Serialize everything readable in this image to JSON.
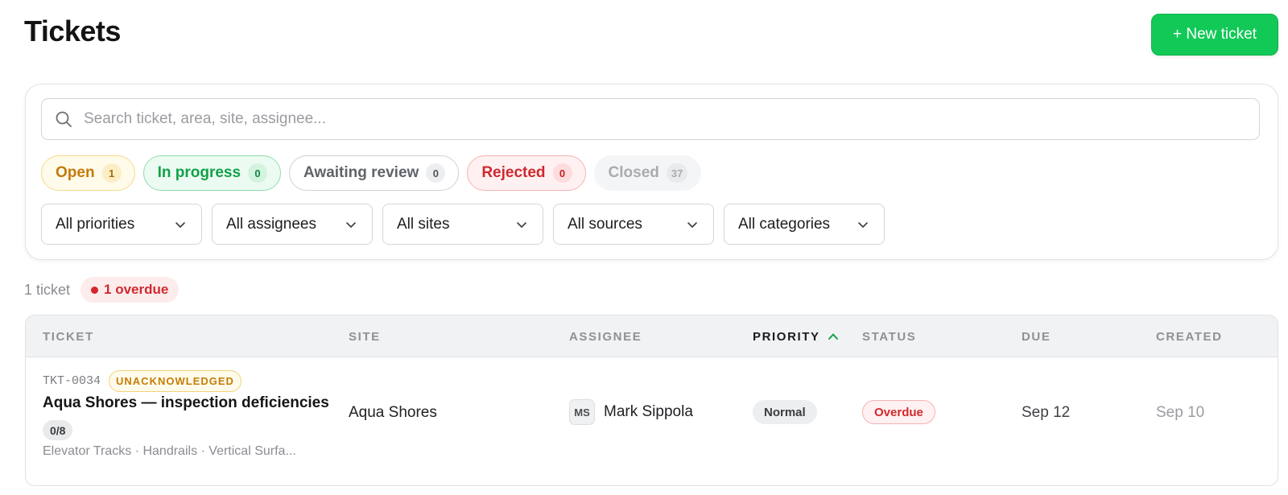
{
  "page": {
    "title": "Tickets"
  },
  "header": {
    "new_ticket_label": "+ New ticket"
  },
  "search": {
    "placeholder": "Search ticket, area, site, assignee..."
  },
  "status_pills": [
    {
      "label": "Open",
      "count": "1"
    },
    {
      "label": "In progress",
      "count": "0"
    },
    {
      "label": "Awaiting review",
      "count": "0"
    },
    {
      "label": "Rejected",
      "count": "0"
    },
    {
      "label": "Closed",
      "count": "37"
    }
  ],
  "filters": [
    {
      "selected": "All priorities"
    },
    {
      "selected": "All assignees"
    },
    {
      "selected": "All sites"
    },
    {
      "selected": "All sources"
    },
    {
      "selected": "All categories"
    }
  ],
  "summary": {
    "ticket_count": "1 ticket",
    "overdue": "1 overdue"
  },
  "table": {
    "columns": [
      "TICKET",
      "SITE",
      "ASSIGNEE",
      "PRIORITY",
      "STATUS",
      "DUE",
      "CREATED"
    ],
    "sorted_column": "PRIORITY",
    "sort_direction": "ascending",
    "rows": [
      {
        "id": "TKT-0034",
        "ack_status": "UNACKNOWLEDGED",
        "title": "Aqua Shores — inspection deficiencies",
        "progress": "0/8",
        "areas": "Elevator Tracks · Handrails · Vertical Surfa...",
        "site": "Aqua Shores",
        "assignee_initials": "MS",
        "assignee_name": "Mark Sippola",
        "priority": "Normal",
        "status": "Overdue",
        "due": "Sep 12",
        "created": "Sep 10"
      }
    ]
  },
  "colors": {
    "accent": "#12c957",
    "open": "#c47a0b",
    "in_progress": "#12a049",
    "rejected": "#d0282f",
    "overdue": "#cf2a2f"
  },
  "icons": {
    "search": "search-icon",
    "dropdown": "chevron-down-icon",
    "sort": "chevron-up-icon"
  }
}
